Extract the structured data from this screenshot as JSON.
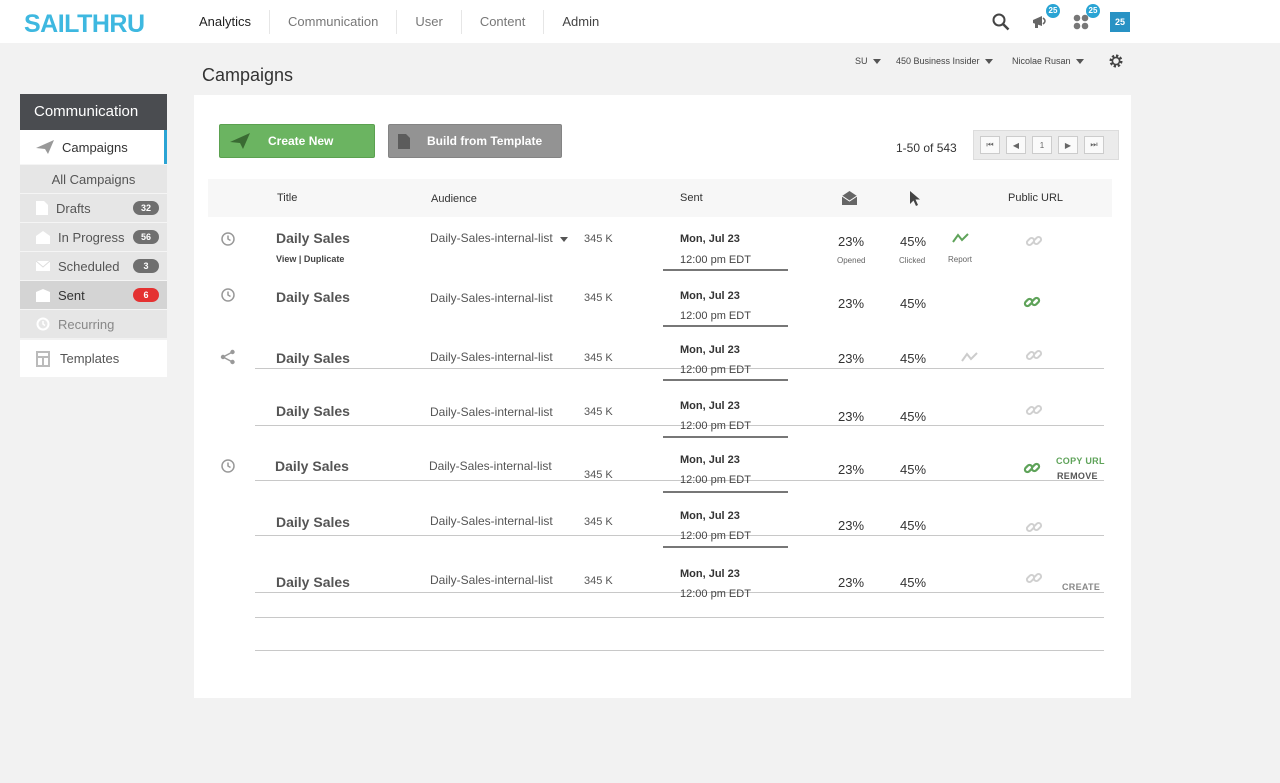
{
  "brand": {
    "logo": "SAILTHRU",
    "logo_color": "#3eb8e0",
    "accent": "#2aa4d4",
    "green": "#6bb461"
  },
  "nav": {
    "items": [
      "Analytics",
      "Communication",
      "User",
      "Content",
      "Admin"
    ]
  },
  "top_icons": {
    "search": "search-icon",
    "announcements_badge": "25",
    "apps_badge": "25",
    "user_square": "25"
  },
  "account": {
    "site": "SU",
    "business": "450 Business Insider",
    "user": "Nicolae Rusan"
  },
  "page": {
    "title": "Campaigns"
  },
  "sidebar": {
    "header": "Communication",
    "campaigns": "Campaigns",
    "all_campaigns": "All Campaigns",
    "items": [
      {
        "label": "Drafts",
        "count": "32"
      },
      {
        "label": "In Progress",
        "count": "56"
      },
      {
        "label": "Scheduled",
        "count": "3"
      },
      {
        "label": "Sent",
        "count": "6"
      },
      {
        "label": "Recurring",
        "count": ""
      }
    ],
    "templates": "Templates"
  },
  "toolbar": {
    "create_new": "Create New",
    "build_from_template": "Build from Template"
  },
  "pager": {
    "range": "1-50 of 543",
    "page": "1"
  },
  "table": {
    "headers": {
      "title": "Title",
      "audience": "Audience",
      "sent": "Sent",
      "public_url": "Public URL"
    },
    "rows": [
      {
        "title": "Daily Sales",
        "view": "View",
        "duplicate": "Duplicate",
        "sep": "|",
        "audience": "Daily-Sales-internal-list",
        "size": "345 K",
        "date": "Mon, Jul 23",
        "time": "12:00 pm EDT",
        "opened": "23%",
        "opened_label": "Opened",
        "clicked": "45%",
        "clicked_label": "Clicked",
        "report_label": "Report"
      },
      {
        "title": "Daily Sales",
        "audience": "Daily-Sales-internal-list",
        "size": "345 K",
        "date": "Mon, Jul 23",
        "time": "12:00 pm EDT",
        "opened": "23%",
        "clicked": "45%"
      },
      {
        "title": "Daily Sales",
        "audience": "Daily-Sales-internal-list",
        "size": "345 K",
        "date": "Mon, Jul 23",
        "time": "12:00 pm EDT",
        "opened": "23%",
        "clicked": "45%"
      },
      {
        "title": "Daily Sales",
        "audience": "Daily-Sales-internal-list",
        "size": "345 K",
        "date": "Mon, Jul 23",
        "time": "12:00 pm EDT",
        "opened": "23%",
        "clicked": "45%"
      },
      {
        "title": "Daily Sales",
        "audience": "Daily-Sales-internal-list",
        "size": "345 K",
        "date": "Mon, Jul 23",
        "time": "12:00 pm EDT",
        "opened": "23%",
        "clicked": "45%",
        "copy_url": "COPY URL",
        "remove": "REMOVE"
      },
      {
        "title": "Daily Sales",
        "audience": "Daily-Sales-internal-list",
        "size": "345 K",
        "date": "Mon, Jul 23",
        "time": "12:00 pm EDT",
        "opened": "23%",
        "clicked": "45%"
      },
      {
        "title": "Daily Sales",
        "audience": "Daily-Sales-internal-list",
        "size": "345 K",
        "date": "Mon, Jul 23",
        "time": "12:00 pm EDT",
        "opened": "23%",
        "clicked": "45%",
        "create": "CREATE"
      }
    ]
  }
}
